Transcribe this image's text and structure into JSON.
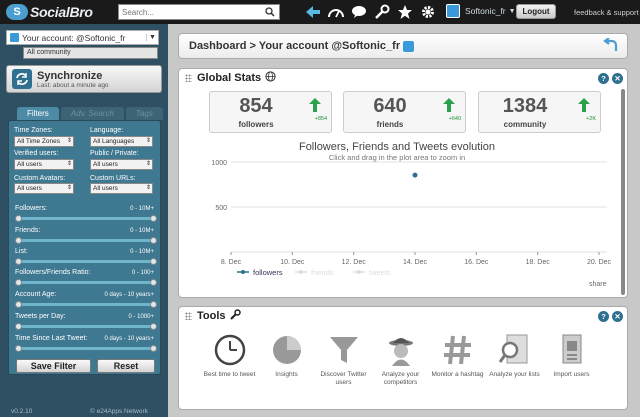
{
  "topbar": {
    "logo_text": "SocialBro",
    "search_placeholder": "Search...",
    "account_name": "Softonic_fr",
    "logout_label": "Logout",
    "feedback_label": "feedback & support"
  },
  "sidebar": {
    "account_label": "Your account: @Softonic_fr",
    "community_label": "All community",
    "sync_title": "Synchronize",
    "sync_subtitle": "Last: about a minute ago",
    "tabs": [
      {
        "label": "Filters"
      },
      {
        "label": "Adv. Search"
      },
      {
        "label": "Tags"
      }
    ],
    "filters": {
      "time_zones_label": "Time Zones:",
      "time_zones_value": "All Time Zones",
      "language_label": "Language:",
      "language_value": "All Languages",
      "verified_label": "Verified users:",
      "verified_value": "All users",
      "public_private_label": "Public / Private:",
      "public_private_value": "All users",
      "avatars_label": "Custom Avatars:",
      "avatars_value": "All users",
      "urls_label": "Custom URLs:",
      "urls_value": "All users",
      "ranges": [
        {
          "label": "Followers:",
          "value": "0 - 10M+"
        },
        {
          "label": "Friends:",
          "value": "0 - 10M+"
        },
        {
          "label": "List:",
          "value": "0 - 10M+"
        },
        {
          "label": "Followers/Friends Ratio:",
          "value": "0 - 100+"
        },
        {
          "label": "Account Age:",
          "value": "0 days - 10 years+"
        },
        {
          "label": "Tweets per Day:",
          "value": "0 - 1000+"
        },
        {
          "label": "Time Since Last Tweet:",
          "value": "0 days - 10 years+"
        }
      ]
    },
    "save_filter_label": "Save Filter",
    "reset_label": "Reset",
    "version": "v0.2.10",
    "network": "© e24Apps Network"
  },
  "main": {
    "breadcrumb": "Dashboard > Your account @Softonic_fr",
    "global_stats": {
      "title": "Global Stats",
      "stats": [
        {
          "value": "854",
          "label": "followers",
          "delta": "+854"
        },
        {
          "value": "640",
          "label": "friends",
          "delta": "+640"
        },
        {
          "value": "1384",
          "label": "community",
          "delta": "+2K"
        }
      ]
    },
    "chart_title": "Followers, Friends and Tweets evolution",
    "chart_subtitle": "Click and drag in the plot area to zoom in",
    "share_label": "share",
    "tools": {
      "title": "Tools",
      "items": [
        {
          "label": "Best time to tweet",
          "icon": "clock-icon"
        },
        {
          "label": "Insights",
          "icon": "pie-icon"
        },
        {
          "label": "Discover Twitter users",
          "icon": "funnel-icon"
        },
        {
          "label": "Analyze your competitors",
          "icon": "spy-icon"
        },
        {
          "label": "Monitor a hashtag",
          "icon": "hashtag-icon"
        },
        {
          "label": "Analyze your lists",
          "icon": "magnifier-doc-icon"
        },
        {
          "label": "Import users",
          "icon": "import-icon"
        }
      ]
    }
  },
  "chart_data": {
    "type": "line",
    "title": "Followers, Friends and Tweets evolution",
    "subtitle": "Click and drag in the plot area to zoom in",
    "x": [
      "8. Dec",
      "10. Dec",
      "12. Dec",
      "14. Dec",
      "16. Dec",
      "18. Dec",
      "20. Dec"
    ],
    "yticks": [
      0,
      500,
      1000
    ],
    "ylim": [
      0,
      1000
    ],
    "series": [
      {
        "name": "followers",
        "points": [
          {
            "x": "14. Dec",
            "y": 854
          }
        ],
        "color": "#2f6f8f"
      },
      {
        "name": "friends",
        "points": [],
        "color": "#cccccc"
      },
      {
        "name": "tweets",
        "points": [],
        "color": "#cccccc"
      }
    ],
    "legend": "bottom-left",
    "grid": true
  }
}
